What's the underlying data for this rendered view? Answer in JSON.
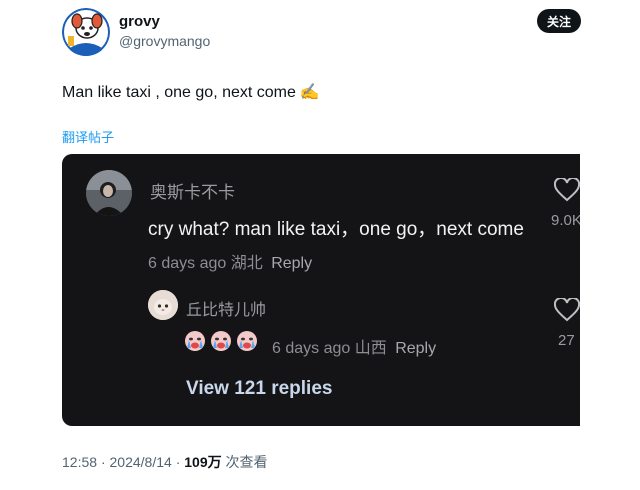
{
  "post": {
    "display_name": "grovy",
    "handle": "@grovymango",
    "follow_label": "关注",
    "text": "Man like taxi , one go, next come",
    "emoji": "✍️",
    "translate_label": "翻译帖子",
    "time": "12:58",
    "date": "2024/8/14",
    "separator": "·",
    "views_count": "109万",
    "views_label": "次查看"
  },
  "embedded_comments": {
    "comment1": {
      "author": "奥斯卡不卡",
      "text": "cry what? man like taxi，one go，next come",
      "age": "6 days ago",
      "location": "湖北",
      "reply_label": "Reply",
      "like_count": "9.0K"
    },
    "comment2": {
      "author": "丘比特儿帅",
      "emojis": "😭😭😭",
      "age": "6 days ago",
      "location": "山西",
      "reply_label": "Reply",
      "like_count": "27"
    },
    "view_replies_label": "View 121 replies"
  },
  "colors": {
    "accent_link": "#1d9bf0",
    "embed_background": "#141416",
    "follow_button": "#0f1419"
  }
}
